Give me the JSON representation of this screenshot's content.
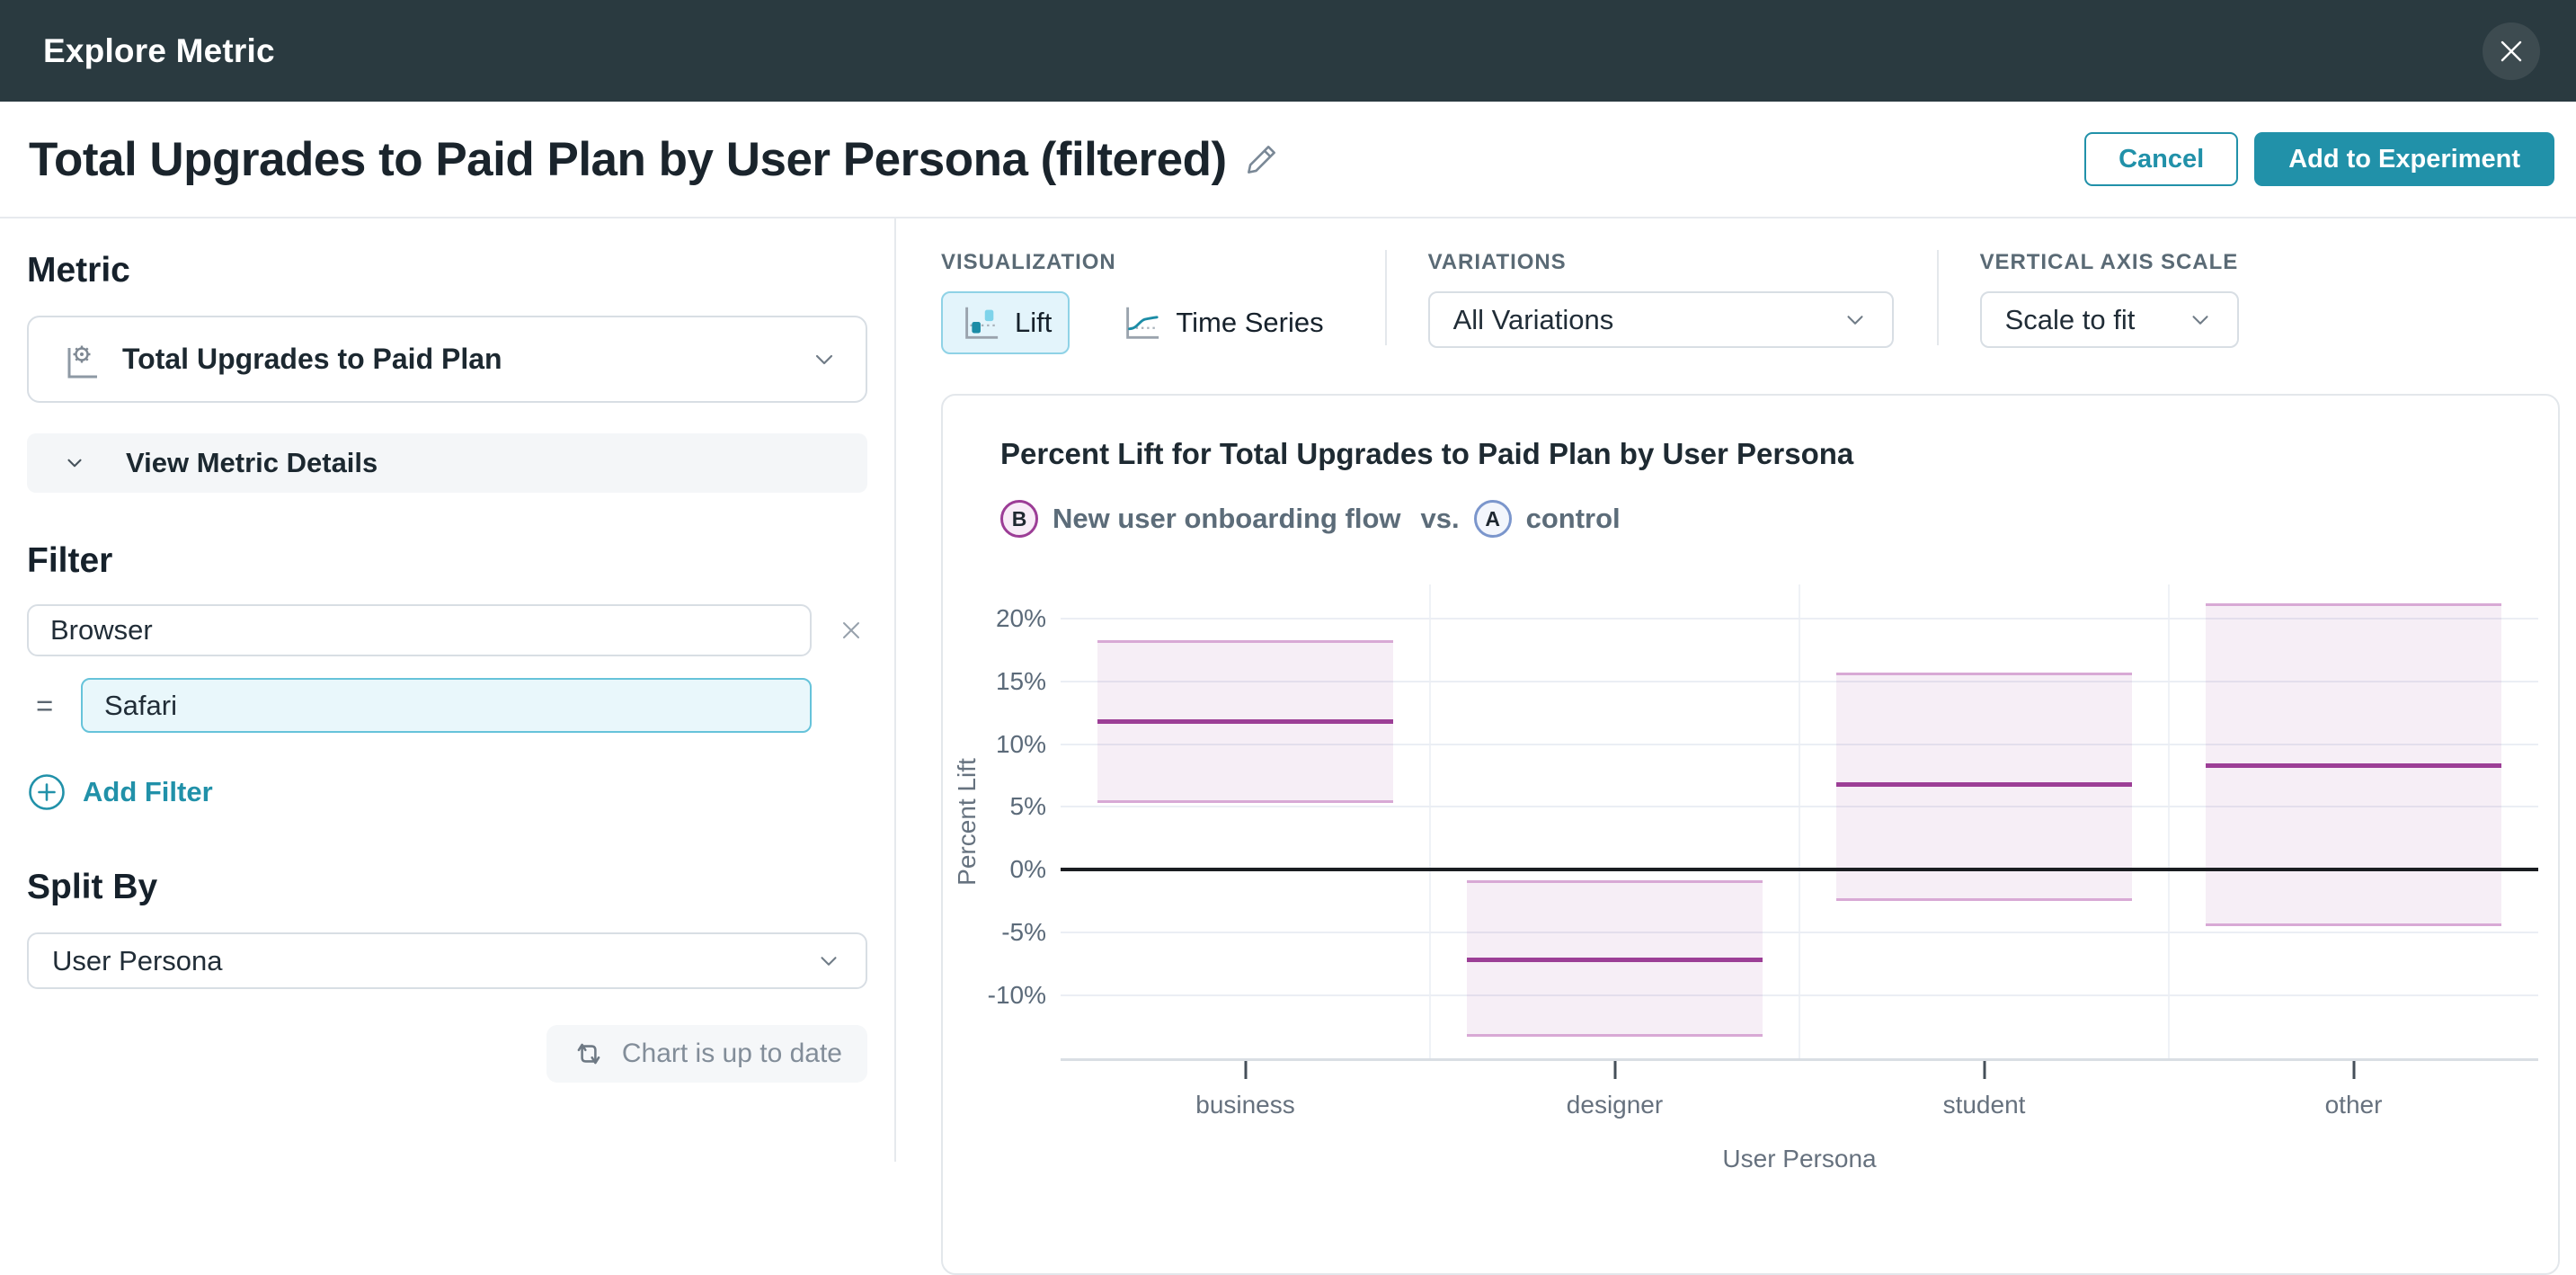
{
  "colors": {
    "accent": "#2191A9",
    "header_bg": "#2A3A40",
    "bar_fill": "rgba(156,63,150,0.085)",
    "bar_edge": "#D8A9D5",
    "bar_center_line": "#9C3E96",
    "legend_b_border": "#9C3D96",
    "legend_a_border": "#7B96CC"
  },
  "modal": {
    "title": "Explore Metric"
  },
  "title_bar": {
    "title": "Total Upgrades to Paid Plan by User Persona (filtered)",
    "cancel": "Cancel",
    "add_to_experiment": "Add to Experiment"
  },
  "left_panel": {
    "metric_heading": "Metric",
    "metric_selected": "Total Upgrades to Paid Plan",
    "view_metric_details": "View Metric Details",
    "filter_heading": "Filter",
    "filter_field": "Browser",
    "filter_operator": "=",
    "filter_value": "Safari",
    "add_filter": "Add Filter",
    "split_heading": "Split By",
    "split_selected": "User Persona",
    "status": "Chart is up to date"
  },
  "controls": {
    "visualization_label": "VISUALIZATION",
    "lift": "Lift",
    "time_series": "Time Series",
    "variations_label": "VARIATIONS",
    "variations_selected": "All Variations",
    "axis_scale_label": "VERTICAL AXIS SCALE",
    "axis_scale_selected": "Scale to fit"
  },
  "chart": {
    "title": "Percent Lift for Total Upgrades to Paid Plan by User Persona",
    "legend_b_letter": "B",
    "legend_b_name": "New user onboarding flow",
    "legend_vs": "vs.",
    "legend_a_letter": "A",
    "legend_a_name": "control"
  },
  "chart_data": {
    "type": "bar",
    "title": "Percent Lift for Total Upgrades to Paid Plan by User Persona",
    "xlabel": "User Persona",
    "ylabel": "Percent Lift",
    "categories": [
      "business",
      "designer",
      "student",
      "other"
    ],
    "series": [
      {
        "name": "B: New user onboarding flow vs. A: control",
        "lift_pct": [
          11.8,
          -7.1,
          6.8,
          8.3
        ],
        "ci_low_pct": [
          5.3,
          -13.3,
          -2.5,
          -4.5
        ],
        "ci_high_pct": [
          18.3,
          -0.8,
          15.7,
          21.2
        ]
      }
    ],
    "yticks_pct": [
      20,
      15,
      10,
      5,
      0,
      -5,
      -10
    ],
    "ylim_pct": [
      -15,
      22.7
    ],
    "zero_line": true,
    "grid": true,
    "legend_position": "top-left"
  }
}
